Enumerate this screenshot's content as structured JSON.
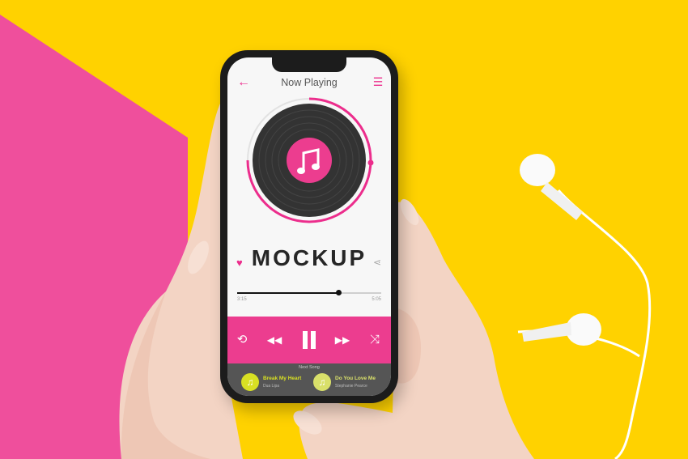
{
  "colors": {
    "background_yellow": "#ffd200",
    "background_pink": "#ef4f9c",
    "accent": "#ec2d8c",
    "controls_bar": "#ec3d8f",
    "next_bar": "#555555",
    "song_1_icon": "#d8e023",
    "song_2_icon": "#d9e06a"
  },
  "header": {
    "back_icon": "arrow-left-icon",
    "title": "Now Playing",
    "menu_icon": "hamburger-menu-icon"
  },
  "player": {
    "disc_icon": "music-note-icon",
    "track_title": "MOCKUP",
    "favorite_icon": "heart-icon",
    "share_icon": "share-icon",
    "progress_fraction": 0.7,
    "elapsed": "3:15",
    "duration": "5:05"
  },
  "controls": {
    "repeat_icon": "repeat-icon",
    "previous_icon": "rewind-icon",
    "pause_icon": "pause-icon",
    "next_icon": "fast-forward-icon",
    "shuffle_icon": "shuffle-icon"
  },
  "next_song": {
    "label": "Next Song",
    "items": [
      {
        "title": "Break My Heart",
        "artist": "Dua Lipa",
        "icon": "music-note-icon"
      },
      {
        "title": "Do You Love Me",
        "artist": "Stephanie Pearce",
        "icon": "music-note-icon"
      }
    ]
  }
}
